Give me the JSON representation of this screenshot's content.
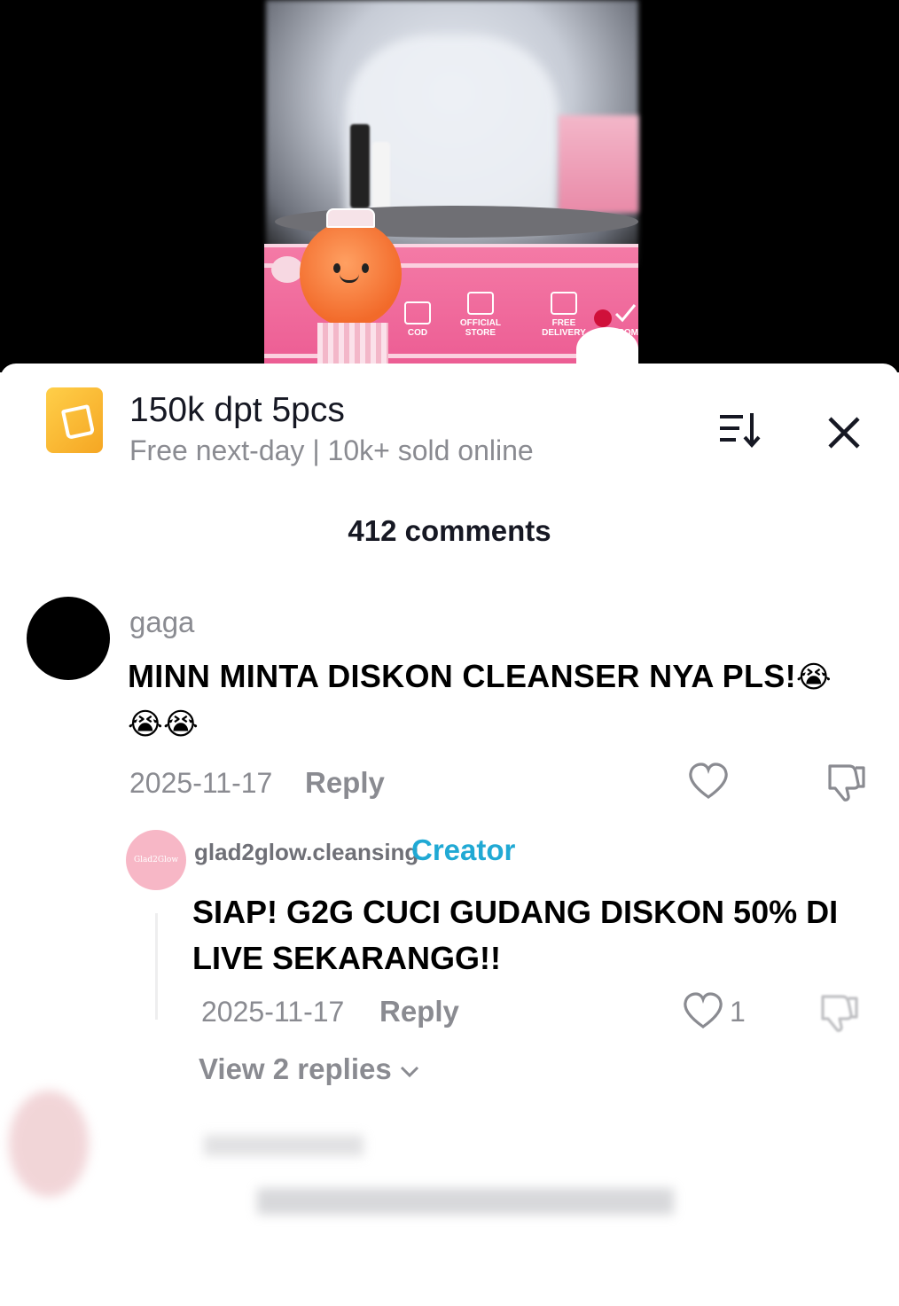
{
  "product": {
    "title": "150k dpt 5pcs",
    "subtitle": "Free next-day | 10k+ sold online"
  },
  "video_banner": {
    "badges": [
      "COD",
      "OFFICIAL STORE",
      "FREE DELIVERY",
      "BPOM"
    ]
  },
  "comments_header": {
    "count_label": "412 comments"
  },
  "comment": {
    "username": "gaga",
    "text": "MINN MINTA DISKON CLEANSER NYA PLS!",
    "emojis_inline": "😭",
    "emojis_trailing": "😭😭",
    "date": "2025-11-17",
    "reply_label": "Reply"
  },
  "reply": {
    "avatar_text": "Glad2Glow",
    "username": "glad2glow.cleansing",
    "tag": "Creator",
    "text": "SIAP! G2G CUCI GUDANG DISKON 50% DI LIVE SEKARANGG!!",
    "date": "2025-11-17",
    "reply_label": "Reply",
    "like_count": "1"
  },
  "view_replies": {
    "label": "View 2 replies"
  },
  "colors": {
    "accent_creator": "#20a9d4",
    "muted_text": "#8a8b91",
    "banner_pink": "#ec5c93",
    "product_icon": "#f5a623"
  },
  "icons": [
    "shopping-bag-icon",
    "sort-icon",
    "close-icon",
    "heart-icon",
    "dislike-icon",
    "chevron-down-icon"
  ]
}
